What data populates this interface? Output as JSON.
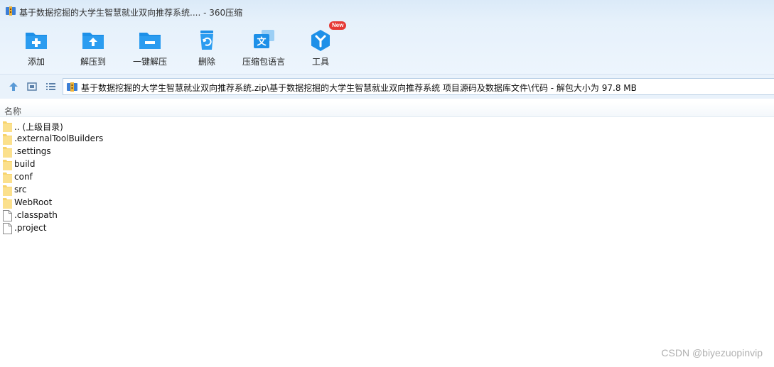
{
  "window": {
    "title": "基于数据挖掘的大学生智慧就业双向推荐系统.... - 360压缩"
  },
  "toolbar": {
    "items": [
      {
        "label": "添加",
        "icon": "add-folder-icon"
      },
      {
        "label": "解压到",
        "icon": "extract-to-icon"
      },
      {
        "label": "一键解压",
        "icon": "one-click-extract-icon"
      },
      {
        "label": "删除",
        "icon": "delete-bin-icon"
      },
      {
        "label": "压缩包语言",
        "icon": "language-icon"
      },
      {
        "label": "工具",
        "icon": "tools-icon",
        "badge": "New"
      }
    ]
  },
  "address": {
    "path": "基于数据挖掘的大学生智慧就业双向推荐系统.zip\\基于数据挖掘的大学生智慧就业双向推荐系统 项目源码及数据库文件\\代码 - 解包大小为 97.8 MB"
  },
  "list": {
    "column_name": "名称",
    "files": [
      {
        "name": ".. (上级目录)",
        "type": "folder"
      },
      {
        "name": ".externalToolBuilders",
        "type": "folder"
      },
      {
        "name": ".settings",
        "type": "folder"
      },
      {
        "name": "build",
        "type": "folder"
      },
      {
        "name": "conf",
        "type": "folder"
      },
      {
        "name": "src",
        "type": "folder"
      },
      {
        "name": "WebRoot",
        "type": "folder"
      },
      {
        "name": ".classpath",
        "type": "file"
      },
      {
        "name": ".project",
        "type": "file"
      }
    ]
  },
  "watermark": "CSDN @biyezuopinvip",
  "colors": {
    "accent_blue": "#1e90e8",
    "folder_yellow": "#f7d36b",
    "badge_red": "#e53935"
  }
}
